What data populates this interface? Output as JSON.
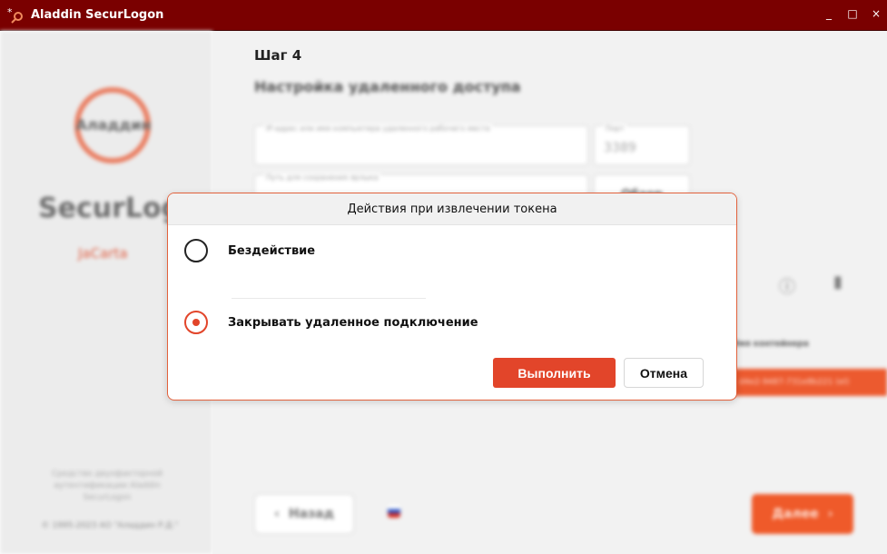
{
  "window": {
    "title": "Aladdin SecurLogon",
    "controls": {
      "minimize": "_",
      "maximize": "□",
      "close": "×"
    }
  },
  "sidebar": {
    "logo_text": "Аладдин",
    "product_name": "SecurLogon",
    "product_sub": "JaCarta",
    "footer_text": "Средство двухфакторной аутентификации Aladdin SecurLogon",
    "copyright": "© 1995-2023 АО \"Аладдин Р.Д.\""
  },
  "main": {
    "step": "Шаг 4",
    "heading": "Настройка удаленного доступа",
    "host_field": {
      "label": "IP-адрес или имя компьютера удаленного рабочего места",
      "value": ""
    },
    "port_field": {
      "label": "Порт",
      "value": "3389"
    },
    "path_field": {
      "label": "Путь для сохранения ярлыка",
      "value": ""
    },
    "browse_label": "Обзор",
    "container_header": "Имя контейнера",
    "container_value": "d4e2-9487-731e8b221 (el)",
    "back_label": "Назад",
    "next_label": "Далее"
  },
  "dialog": {
    "title": "Действия при извлечении токена",
    "options": [
      {
        "label": "Бездействие",
        "selected": false
      },
      {
        "label": "Закрывать удаленное подключение",
        "selected": true
      }
    ],
    "primary_label": "Выполнить",
    "cancel_label": "Отмена"
  },
  "colors": {
    "titlebar": "#7a0000",
    "accent": "#e2452a",
    "sidebar_bg": "#ececec",
    "main_bg": "#f2f2f2"
  }
}
